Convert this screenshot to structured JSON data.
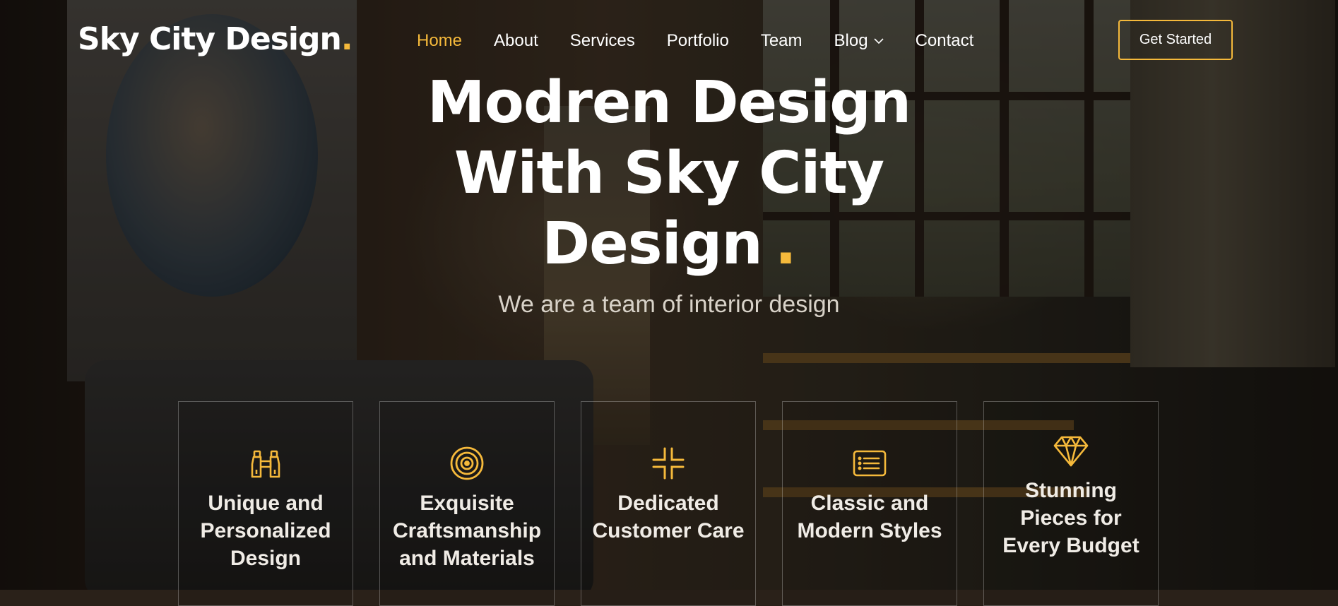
{
  "brand": {
    "name": "Sky City Design",
    "dot": ".",
    "accent": "#f5b93b"
  },
  "nav": {
    "items": [
      {
        "label": "Home",
        "active": true
      },
      {
        "label": "About"
      },
      {
        "label": "Services"
      },
      {
        "label": "Portfolio"
      },
      {
        "label": "Team"
      },
      {
        "label": "Blog",
        "has_dropdown": true,
        "icon": "chevron-down-icon"
      },
      {
        "label": "Contact"
      }
    ],
    "cta_label": "Get Started"
  },
  "hero": {
    "title_lines": [
      "Modren Design",
      "With Sky City",
      "Design"
    ],
    "title_dot": ".",
    "subtitle": "We are a team of interior design"
  },
  "features": [
    {
      "icon": "binoculars-icon",
      "title": "Unique and Personalized Design"
    },
    {
      "icon": "bullseye-icon",
      "title": "Exquisite Craftsmanship and Materials"
    },
    {
      "icon": "fullscreen-exit-icon",
      "title": "Dedicated Customer Care"
    },
    {
      "icon": "card-list-icon",
      "title": "Classic and Modern Styles"
    },
    {
      "icon": "gem-icon",
      "title": "Stunning Pieces for Every Budget"
    }
  ]
}
